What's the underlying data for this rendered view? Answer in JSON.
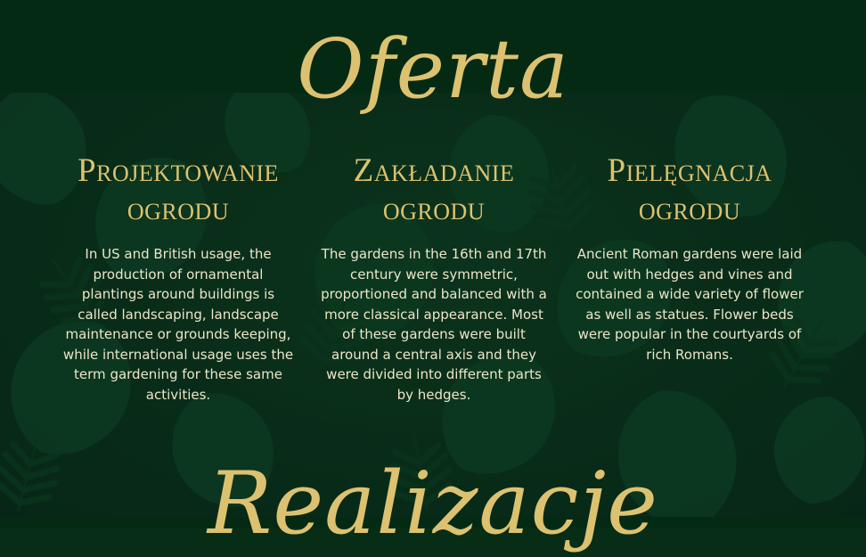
{
  "header": {
    "title": "Oferta"
  },
  "services": [
    {
      "title_line1": "Projektowanie",
      "title_line2": "ogrodu",
      "description": "In US and British usage, the production of ornamental plantings around buildings is called landscaping, landscape maintenance or grounds keeping, while international usage uses the term gardening for these same activities."
    },
    {
      "title_line1": "Zakładanie",
      "title_line2": "ogrodu",
      "description": "The gardens in the 16th and 17th century were symmetric, proportioned and balanced with a more classical appearance. Most of these gardens were built around a central axis and they were divided into different parts by hedges."
    },
    {
      "title_line1": "Pielęgnacja",
      "title_line2": "ogrodu",
      "description": "Ancient Roman gardens were laid out with hedges and vines and contained a wide variety of flower as well as statues. Flower beds were popular in the courtyards of rich Romans."
    }
  ],
  "next_section": {
    "title": "Realizacje"
  },
  "colors": {
    "background": "#072d17",
    "gold": "#dcc270",
    "text": "#ece6c8"
  }
}
